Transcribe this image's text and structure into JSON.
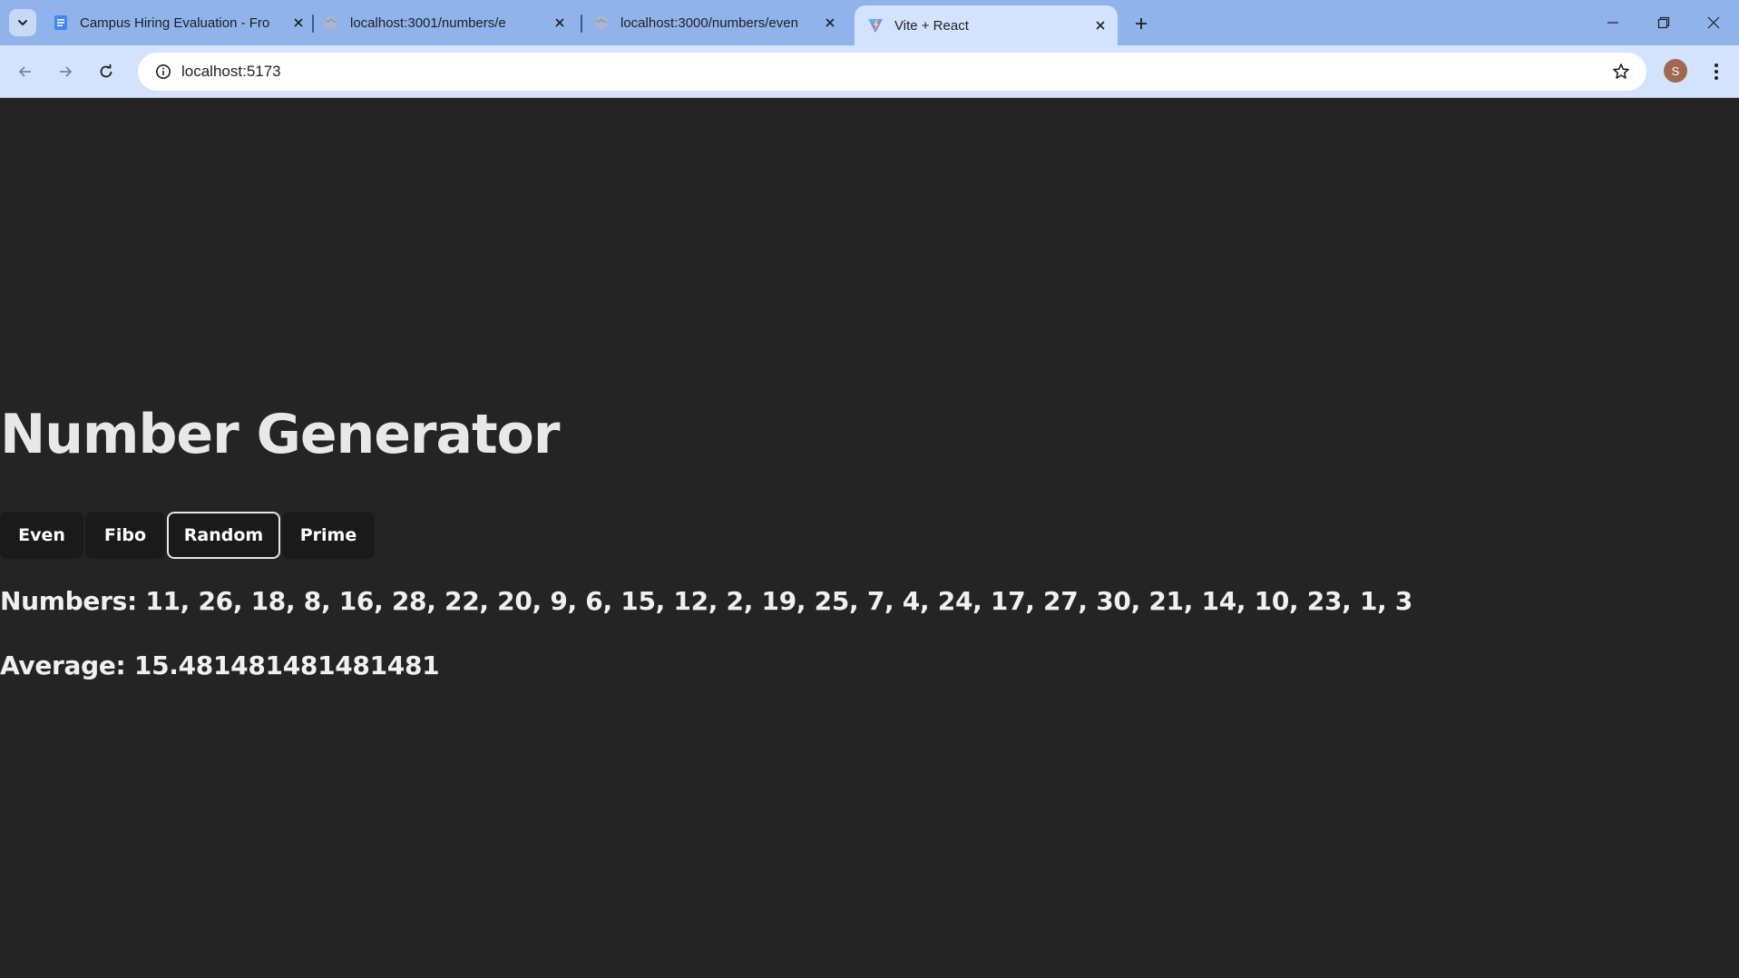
{
  "browser": {
    "tabs": [
      {
        "title": "Campus Hiring Evaluation - Fro",
        "favicon": "docs-icon"
      },
      {
        "title": "localhost:3001/numbers/e",
        "favicon": "globe-icon"
      },
      {
        "title": "localhost:3000/numbers/even",
        "favicon": "globe-icon"
      },
      {
        "title": "Vite + React",
        "favicon": "vite-icon",
        "active": true
      }
    ],
    "url": "localhost:5173",
    "profile_initial": "S",
    "colors": {
      "tabstrip": "#8fb3ea",
      "toolbar": "#d3e3fd",
      "page_bg": "#242424"
    }
  },
  "page": {
    "title": "Number Generator",
    "buttons": [
      "Even",
      "Fibo",
      "Random",
      "Prime"
    ],
    "selected_button": "Random",
    "numbers_label": "Numbers:",
    "numbers": "11, 26, 18, 8, 16, 28, 22, 20, 9, 6, 15, 12, 2, 19, 25, 7, 4, 24, 17, 27, 30, 21, 14, 10, 23, 1, 3",
    "average_label": "Average:",
    "average": "15.481481481481481"
  }
}
